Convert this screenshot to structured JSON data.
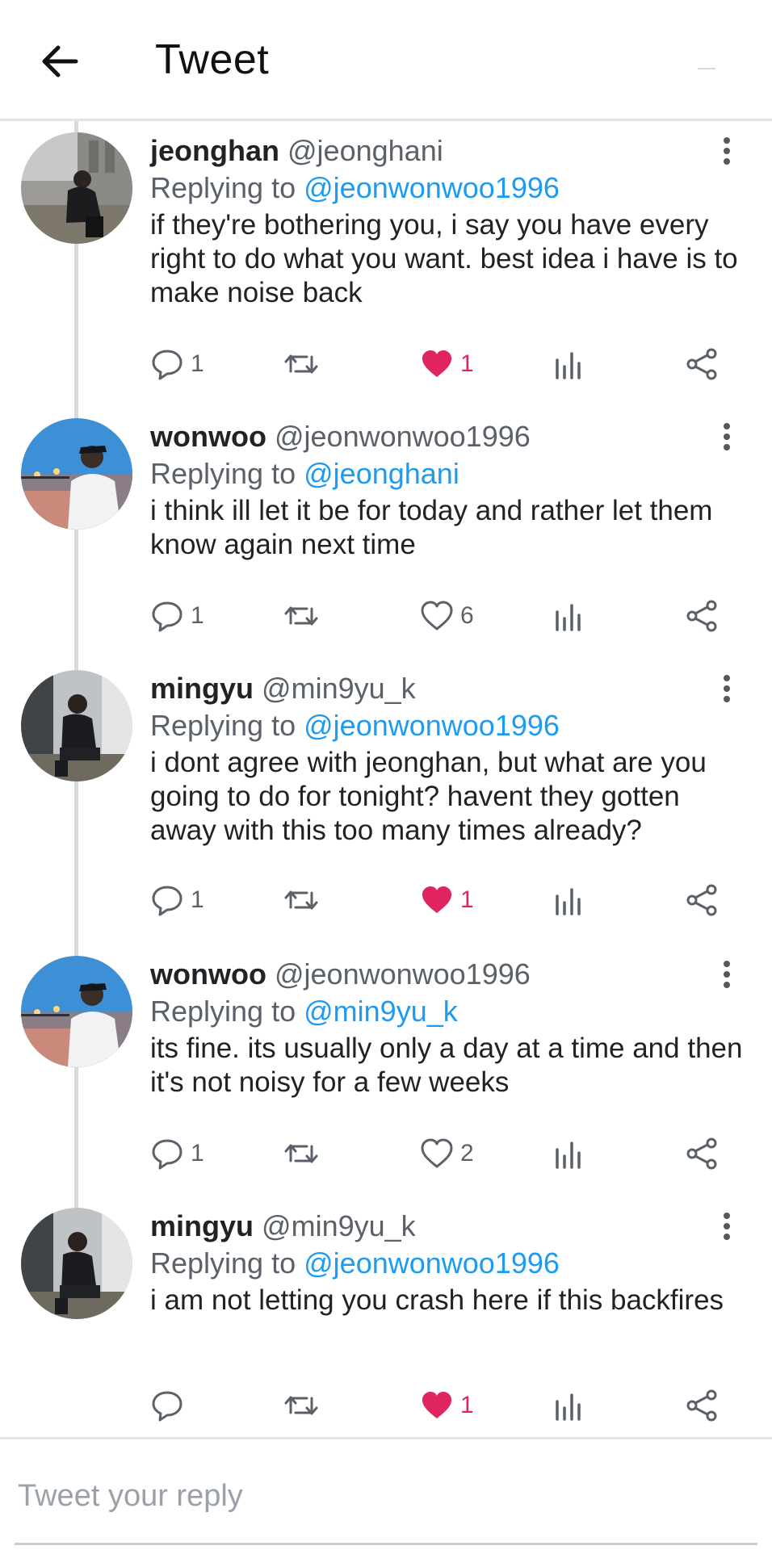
{
  "header": {
    "title": "Tweet",
    "back_icon": "arrow-left-icon"
  },
  "colors": {
    "link": "#1d9bf0",
    "like_active": "#e0245e",
    "muted": "#5a6169",
    "thread_line": "#d7dadd"
  },
  "replies": [
    {
      "name": "jeonghan",
      "handle": "@jeonghani",
      "replying_prefix": "Replying to",
      "replying_to": "@jeonwonwoo1996",
      "text": "if they're bothering you, i say you have every right to do what you want. best idea i have is to make noise back",
      "reply_count": "1",
      "like_count": "1",
      "liked": true
    },
    {
      "name": "wonwoo",
      "handle": "@jeonwonwoo1996",
      "replying_prefix": "Replying to",
      "replying_to": "@jeonghani",
      "text": "i think ill let it be for today and rather let them know again next time",
      "reply_count": "1",
      "like_count": "6",
      "liked": false
    },
    {
      "name": "mingyu",
      "handle": "@min9yu_k",
      "replying_prefix": "Replying to",
      "replying_to": "@jeonwonwoo1996",
      "text": "i dont agree with jeonghan, but what are you going to do for tonight? havent they gotten away with this too many times already?",
      "reply_count": "1",
      "like_count": "1",
      "liked": true
    },
    {
      "name": "wonwoo",
      "handle": "@jeonwonwoo1996",
      "replying_prefix": "Replying to",
      "replying_to": "@min9yu_k",
      "text": "its fine. its usually only a day at a time and then it's not noisy for a few weeks",
      "reply_count": "1",
      "like_count": "2",
      "liked": false
    },
    {
      "name": "mingyu",
      "handle": "@min9yu_k",
      "replying_prefix": "Replying to",
      "replying_to": "@jeonwonwoo1996",
      "text": "i am not letting you crash here if this backfires",
      "reply_count": "",
      "like_count": "1",
      "liked": true
    }
  ],
  "composer": {
    "placeholder": "Tweet your reply"
  }
}
